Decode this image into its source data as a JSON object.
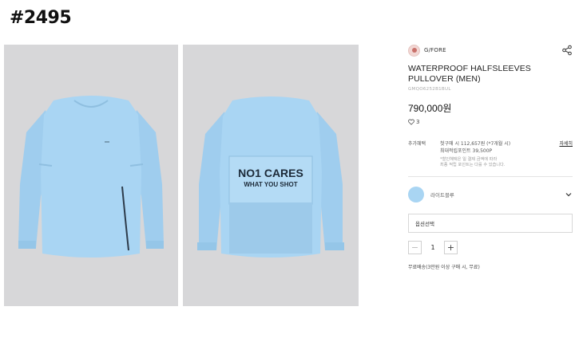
{
  "page_tag": "#2495",
  "product": {
    "brand": "G/FORE",
    "title": "WATERPROOF HALFSLEEVES PULLOVER (MEN)",
    "code": "GMQO6252B1BUL",
    "price": "790,000원",
    "likes": "3"
  },
  "benefit": {
    "label": "추가혜택",
    "line1": "첫구매 시 112,657원 (*7개월 시)",
    "line2": "최대적립포인트  39,500P",
    "detail_link": "자세히",
    "note1": "*할인혜택은 일 결제 금액에 따라",
    "note2": "최종 적립 포인트는 다를 수 있습니다."
  },
  "option": {
    "color_name": "라이트블루",
    "color_hex": "#a9d5f3",
    "select_label": "옵션선택"
  },
  "quantity": {
    "minus": "−",
    "value": "1",
    "plus": "+"
  },
  "shipping": "무료배송(3만원 이상 구매 시, 무료)",
  "images": {
    "front_alt": "front view",
    "back_print_line1": "NO1 CARES",
    "back_print_line2": "WHAT YOU SHOT"
  }
}
